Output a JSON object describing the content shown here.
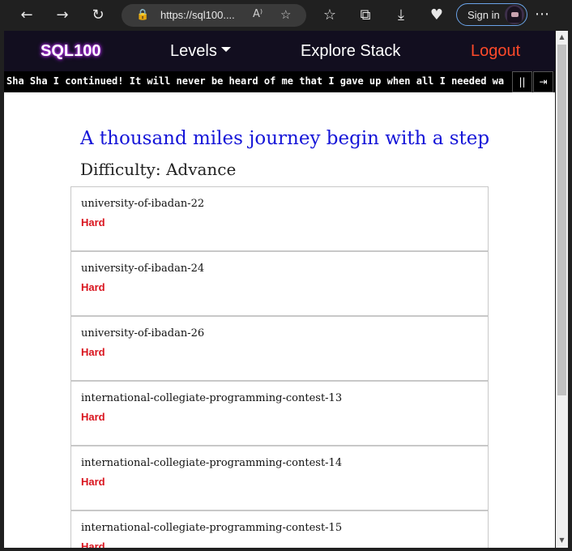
{
  "browser": {
    "url": "https://sql100....",
    "read_aloud_label": "A⁾",
    "sign_in_label": "Sign in",
    "icons": [
      "back-icon",
      "forward-icon",
      "refresh-icon",
      "lock-icon",
      "read-aloud-icon",
      "add-favorite-icon",
      "favorites-icon",
      "collections-icon",
      "downloads-icon",
      "health-icon",
      "profile-avatar-icon",
      "more-icon"
    ]
  },
  "nav": {
    "brand": "SQL100",
    "levels": "Levels",
    "explore": "Explore Stack",
    "logout": "Logout"
  },
  "ticker": {
    "message": "Sha Sha I continued! It will never be heard of me that I gave up when all I needed wa",
    "pause_label": "||",
    "next_label": "⇥"
  },
  "main": {
    "heading": "A thousand miles journey begin with a step",
    "difficulty": "Difficulty: Advance",
    "problems": [
      {
        "title": "university-of-ibadan-22",
        "level": "Hard"
      },
      {
        "title": "university-of-ibadan-24",
        "level": "Hard"
      },
      {
        "title": "university-of-ibadan-26",
        "level": "Hard"
      },
      {
        "title": "international-collegiate-programming-contest-13",
        "level": "Hard"
      },
      {
        "title": "international-collegiate-programming-contest-14",
        "level": "Hard"
      },
      {
        "title": "international-collegiate-programming-contest-15",
        "level": "Hard"
      }
    ]
  },
  "colors": {
    "nav_bg": "#120e1f",
    "heading": "#1616d8",
    "hard": "#d9141e",
    "logout": "#ff4a2a"
  }
}
